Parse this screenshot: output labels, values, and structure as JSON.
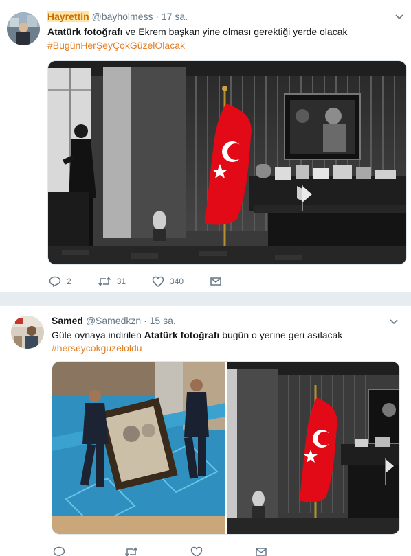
{
  "tweets": [
    {
      "display_name": "Hayrettin",
      "handle": "@bayholmess",
      "separator": "·",
      "time": "17 sa.",
      "text_bold_1": "Atatürk fotoğrafı",
      "text_rest_1": " ve Ekrem başkan yine olması gerektiği yerde olacak",
      "hashtag": "#BugünHerŞeyÇokGüzelOlacak",
      "replies": "2",
      "retweets": "31",
      "likes": "340"
    },
    {
      "display_name": "Samed",
      "handle": "@Samedkzn",
      "separator": "·",
      "time": "15 sa.",
      "text_pre": "Güle oynaya indirilen ",
      "text_bold_1": "Atatürk fotoğrafı",
      "text_rest_1": " bugün o yerine geri asılacak",
      "hashtag": "#herseycokguzeloldu"
    }
  ],
  "icons": {
    "reply": "reply-icon",
    "retweet": "retweet-icon",
    "like": "heart-icon",
    "dm": "envelope-icon",
    "more": "chevron-down-icon"
  },
  "colors": {
    "hashtag": "#e67e22",
    "flag_red": "#e30a17"
  }
}
